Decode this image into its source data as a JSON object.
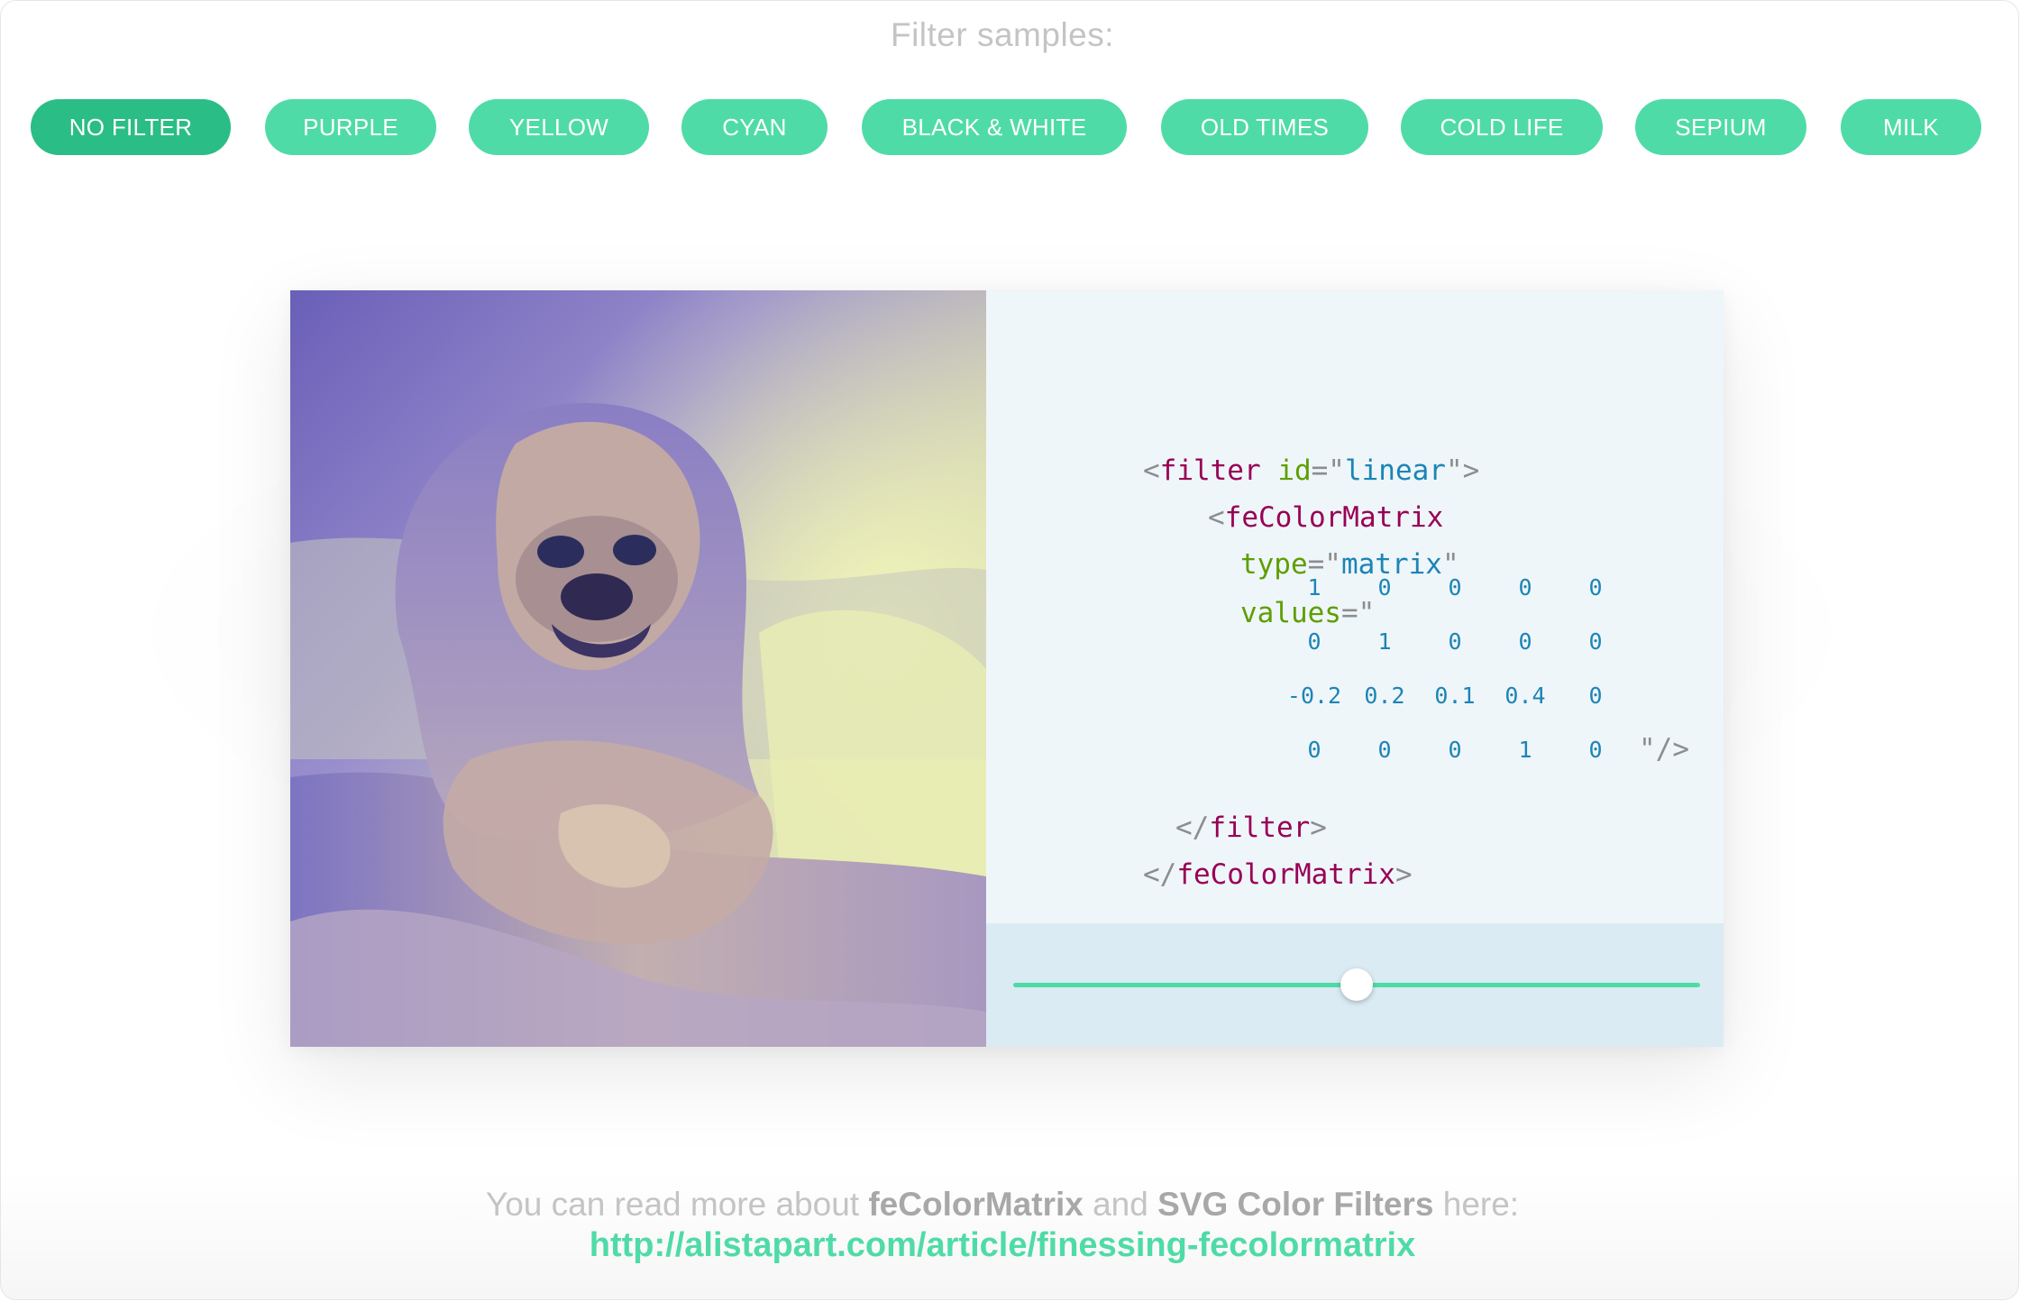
{
  "heading": "Filter samples:",
  "filters": [
    {
      "label": "NO FILTER",
      "active": true
    },
    {
      "label": "PURPLE",
      "active": false
    },
    {
      "label": "YELLOW",
      "active": false
    },
    {
      "label": "CYAN",
      "active": false
    },
    {
      "label": "BLACK & WHITE",
      "active": false
    },
    {
      "label": "OLD TIMES",
      "active": false
    },
    {
      "label": "COLD LIFE",
      "active": false
    },
    {
      "label": "SEPIUM",
      "active": false
    },
    {
      "label": "MILK",
      "active": false
    }
  ],
  "code": {
    "open_bracket": "<",
    "close_bracket": ">",
    "close_open": "</",
    "self_close": "\"/>",
    "eq_quote": "=\"",
    "quote": "\"",
    "filter_tag": "filter",
    "id_attr": "id",
    "id_value": "linear",
    "matrix_tag": "feColorMatrix",
    "type_attr": "type",
    "type_value": "matrix",
    "values_attr": "values",
    "matrix": [
      [
        "1",
        "0",
        "0",
        "0",
        "0"
      ],
      [
        "0",
        "1",
        "0",
        "0",
        "0"
      ],
      [
        "-0.2",
        "0.2",
        "0.1",
        "0.4",
        "0"
      ],
      [
        "0",
        "0",
        "0",
        "1",
        "0"
      ]
    ]
  },
  "slider": {
    "value": 0.5
  },
  "footer": {
    "prefix": "You can read more about ",
    "term1": "feColorMatrix",
    "middle": " and ",
    "term2": "SVG Color Filters",
    "suffix": " here:",
    "link": "http://alistapart.com/article/finessing-fecolormatrix"
  },
  "colors": {
    "accent": "#4fdba7",
    "accent_active": "#2bbd86",
    "tag": "#990055",
    "attr": "#5f9e00",
    "string": "#1d84b5"
  },
  "image": {
    "icon": "pug-in-blanket-photo"
  }
}
